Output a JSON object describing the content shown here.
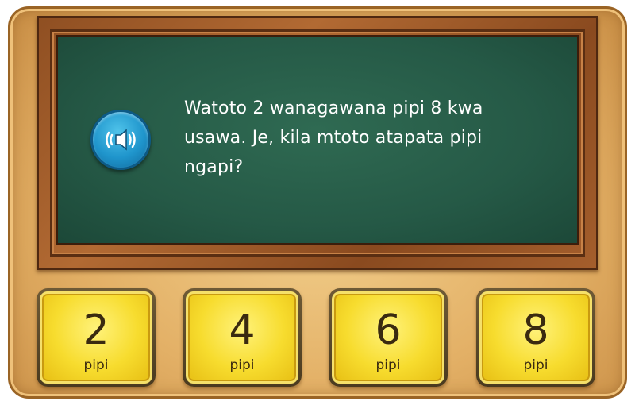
{
  "question": {
    "line1": "Watoto 2 wanagawana pipi 8 kwa",
    "line2": "usawa. Je, kila mtoto atapata pipi",
    "line3": "ngapi?"
  },
  "audio": {
    "icon": "speaker-icon"
  },
  "answers": [
    {
      "value": "2",
      "unit": "pipi"
    },
    {
      "value": "4",
      "unit": "pipi"
    },
    {
      "value": "6",
      "unit": "pipi"
    },
    {
      "value": "8",
      "unit": "pipi"
    }
  ],
  "colors": {
    "chalkboard": "#255946",
    "frame": "#a45e2c",
    "answer_tile": "#f7dc2e",
    "speaker_button": "#1f95cc"
  }
}
